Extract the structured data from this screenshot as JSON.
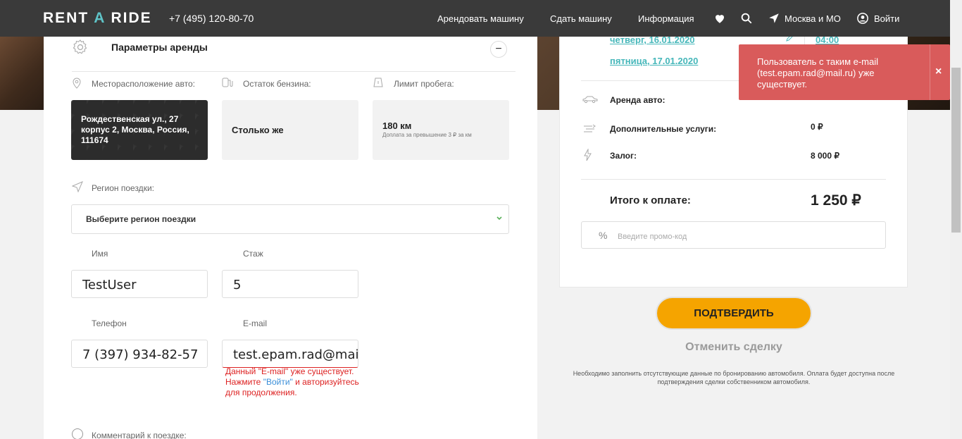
{
  "header": {
    "logo_left": "RENT ",
    "logo_a": "A",
    "logo_right": " RIDE",
    "phone": "+7 (495) 120-80-70",
    "nav": [
      "Арендовать машину",
      "Сдать машину",
      "Информация"
    ],
    "city": "Москва и МО",
    "login": "Войти"
  },
  "form": {
    "section_title": "Параметры аренды",
    "collapse": "−",
    "location_label": "Месторасположение авто:",
    "location_value": "Рождественская ул., 27 корпус 2, Москва, Россия, 111674",
    "fuel_label": "Остаток бензина:",
    "fuel_value": "Столько же",
    "mileage_label": "Лимит пробега:",
    "mileage_value": "180 км",
    "mileage_note": "Доплата за превышение 3 ₽ за км",
    "region_label": "Регион поездки:",
    "region_select": "Выберите регион поездки",
    "name_label": "Имя",
    "name_value": "TestUser",
    "experience_label": "Стаж",
    "experience_value": "5",
    "phone_label": "Телефон",
    "phone_value": "7 (397) 934-82-57",
    "email_label": "E-mail",
    "email_value": "test.epam.rad@mail.ru",
    "email_error_1": "Данный \"E-mail\" уже существует. Нажмите ",
    "email_error_link": "\"Войти\"",
    "email_error_2": " и авторизуйтесь для продолжения.",
    "comment_label": "Комментарий к поездке:"
  },
  "summary": {
    "date_start": "четверг, 16.01.2020",
    "date_end": "пятница, 17.01.2020",
    "time_start": "04:00",
    "rent_label": "Аренда авто:",
    "services_label": "Дополнительные услуги:",
    "services_value": "0 ₽",
    "deposit_label": "Залог:",
    "deposit_value": "8 000 ₽",
    "total_label": "Итого к оплате:",
    "total_value": "1 250 ₽",
    "promo_symbol": "%",
    "promo_placeholder": "Введите промо-код"
  },
  "actions": {
    "confirm": "ПОДТВЕРДИТЬ",
    "cancel": "Отменить сделку",
    "note": "Необходимо заполнить отсутствующие данные по бронированию автомобиля. Оплата будет доступна после подтверждения сделки собственником автомобиля."
  },
  "toast": {
    "message": "Пользователь с таким e-mail (test.epam.rad@mail.ru) уже существует.",
    "close": "×"
  },
  "colors": {
    "header_bg": "#3a3a3a",
    "accent_teal": "#46b7ba",
    "confirm_bg": "#f5a400",
    "toast_bg": "#d95b5b",
    "error_text": "#dd2222"
  }
}
